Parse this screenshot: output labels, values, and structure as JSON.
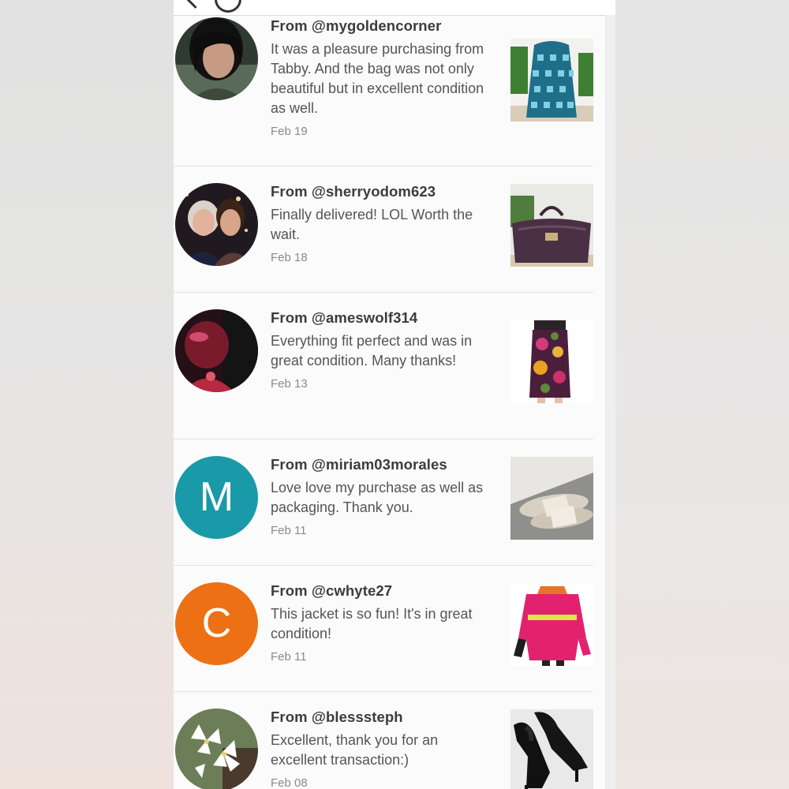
{
  "header": {
    "back_icon": "back-arrow-icon",
    "search_icon": "search-icon"
  },
  "reviews": [
    {
      "handle": "From @mygoldencorner",
      "message": "It was a pleasure purchasing from Tabby. And the bag was not only beautiful but in excellent condition as well.",
      "date": "Feb 19",
      "avatar": "photo",
      "item": "blue patterned backpack"
    },
    {
      "handle": "From @sherryodom623",
      "message": "Finally delivered! LOL Worth the wait.",
      "date": "Feb 18",
      "avatar": "photo",
      "item": "purple handbag"
    },
    {
      "handle": "From @ameswolf314",
      "message": "Everything fit perfect and was in great condition. Many thanks!",
      "date": "Feb 13",
      "avatar": "photo",
      "item": "floral skirt"
    },
    {
      "handle": "From @miriam03morales",
      "message": "Love love my purchase as well as packaging. Thank you.",
      "date": "Feb 11",
      "avatar_letter": "M",
      "avatar_color": "#1a9aa8",
      "item": "sandals"
    },
    {
      "handle": "From @cwhyte27",
      "message": "This jacket is so fun! It's in great condition!",
      "date": "Feb 11",
      "avatar_letter": "C",
      "avatar_color": "#ee7014",
      "item": "pink jacket"
    },
    {
      "handle": "From @blesssteph",
      "message": "Excellent, thank you for an excellent transaction:)",
      "date": "Feb 08",
      "avatar": "photo",
      "item": "black heels"
    }
  ]
}
